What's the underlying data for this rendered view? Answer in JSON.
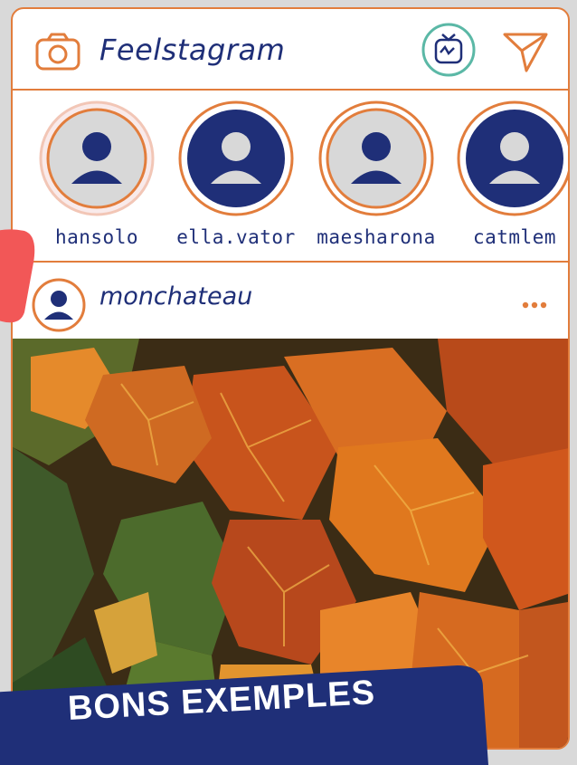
{
  "header": {
    "app_title": "Feelstagram",
    "icons": [
      "camera-icon",
      "igtv-icon",
      "send-icon"
    ]
  },
  "stories": [
    {
      "username": "hansolo",
      "avatar_style": "light"
    },
    {
      "username": "ella.vator",
      "avatar_style": "dark"
    },
    {
      "username": "maesharona",
      "avatar_style": "light"
    },
    {
      "username": "catmlem",
      "avatar_style": "dark"
    }
  ],
  "post": {
    "username": "monchateau",
    "image_description_icon": "autumn-vine-leaves-photo"
  },
  "banner": {
    "text": "BONS EXEMPLES"
  },
  "colors": {
    "accent": "#e27d3c",
    "navy": "#1f2f78",
    "avatar_light_bg": "#d8d8d8",
    "teal": "#5bb8a6",
    "red_tab": "#f25757"
  }
}
